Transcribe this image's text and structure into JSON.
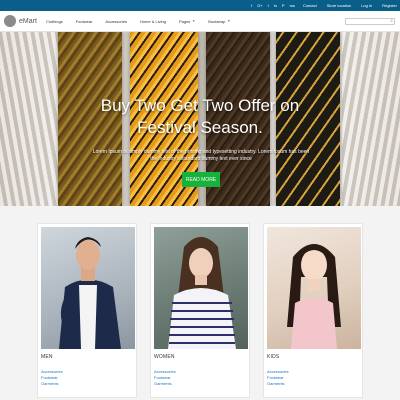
{
  "topbar": {
    "social_icons": [
      "facebook-icon",
      "google-plus-icon",
      "twitter-icon",
      "linkedin-icon",
      "pinterest-icon",
      "rss-icon"
    ],
    "social_glyphs": [
      "f",
      "G+",
      "t",
      "in",
      "P",
      "rss"
    ],
    "links": [
      "Contact",
      "Store location",
      "Log in",
      "Register"
    ]
  },
  "nav": {
    "brand": "eMart",
    "items": [
      "Clothings",
      "Footwear",
      "Accessories",
      "Home & Living",
      "Pages",
      "Bootstrap"
    ]
  },
  "hero": {
    "title": "Buy Two Get Two Offer on Festival Season.",
    "text": "Lorem Ipsum is simply dummy text of the printing and typesetting industry. Lorem Ipsum has been the industry's standard dummy text ever since",
    "button": "READ MORE"
  },
  "categories": [
    {
      "title": "MEN",
      "links": [
        "Accessories",
        "Footwear",
        "Garments"
      ]
    },
    {
      "title": "WOMEN",
      "links": [
        "Accessories",
        "Footwear",
        "Garments"
      ]
    },
    {
      "title": "KIDS",
      "links": [
        "Accessories",
        "Footwear",
        "Garments"
      ]
    }
  ],
  "colors": {
    "topbar": "#0a5e8a",
    "button": "#17b23b",
    "link": "#1e73be"
  }
}
